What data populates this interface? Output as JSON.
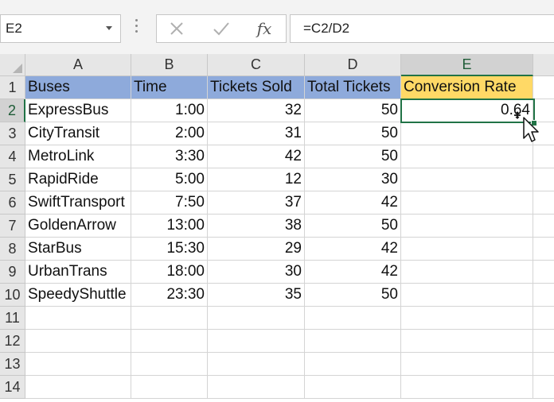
{
  "name_box": {
    "value": "E2"
  },
  "formula_bar": {
    "fx_label": "fx",
    "formula": "=C2/D2"
  },
  "columns": [
    "A",
    "B",
    "C",
    "D",
    "E"
  ],
  "rows": [
    "1",
    "2",
    "3",
    "4",
    "5",
    "6",
    "7",
    "8",
    "9",
    "10",
    "11",
    "12",
    "13",
    "14"
  ],
  "headers": [
    "Buses",
    "Time",
    "Tickets Sold",
    "Total Tickets",
    "Conversion Rate"
  ],
  "data": [
    [
      "ExpressBus",
      "1:00",
      "32",
      "50",
      "0.64"
    ],
    [
      "CityTransit",
      "2:00",
      "31",
      "50",
      ""
    ],
    [
      "MetroLink",
      "3:30",
      "42",
      "50",
      ""
    ],
    [
      "RapidRide",
      "5:00",
      "12",
      "30",
      ""
    ],
    [
      "SwiftTransport",
      "7:50",
      "37",
      "42",
      ""
    ],
    [
      "GoldenArrow",
      "13:00",
      "38",
      "50",
      ""
    ],
    [
      "StarBus",
      "15:30",
      "29",
      "42",
      ""
    ],
    [
      "UrbanTrans",
      "18:00",
      "30",
      "42",
      ""
    ],
    [
      "SpeedyShuttle",
      "23:30",
      "35",
      "50",
      ""
    ]
  ],
  "colors": {
    "header_fill": "#8eaadb",
    "highlight_fill": "#ffd966",
    "selection": "#217346"
  }
}
